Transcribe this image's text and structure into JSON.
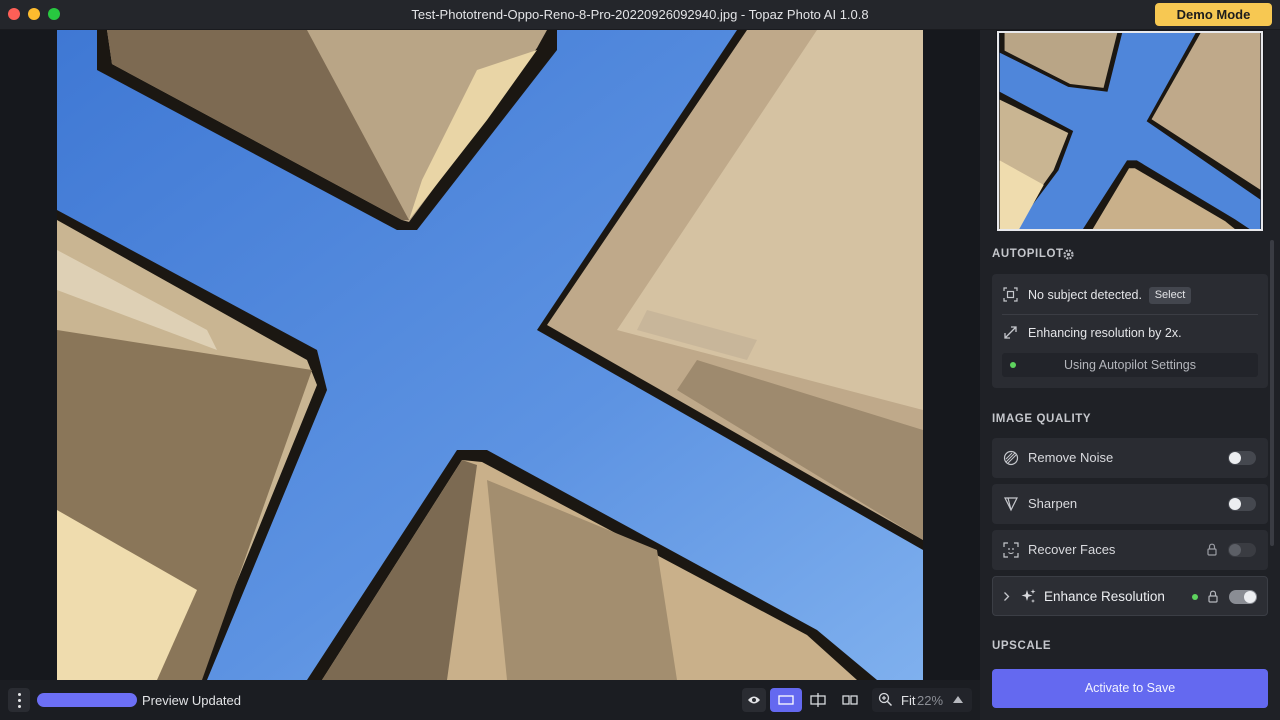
{
  "window": {
    "title": "Test-Phototrend-Oppo-Reno-8-Pro-20220926092940.jpg - Topaz Photo AI 1.0.8",
    "demo_button": "Demo Mode"
  },
  "bottom_bar": {
    "status": "Preview Updated",
    "progress_fraction": 1.0,
    "zoom_fit": "Fit",
    "zoom_percent": "22%"
  },
  "autopilot": {
    "title": "AUTOPILOT",
    "subject_text": "No subject detected.",
    "select_label": "Select",
    "resolution_text": "Enhancing resolution by 2x.",
    "settings_label": "Using Autopilot Settings"
  },
  "image_quality": {
    "title": "IMAGE QUALITY",
    "filters": [
      {
        "label": "Remove Noise",
        "enabled": false,
        "locked": false
      },
      {
        "label": "Sharpen",
        "enabled": false,
        "locked": false
      },
      {
        "label": "Recover Faces",
        "enabled": false,
        "locked": true
      },
      {
        "label": "Enhance Resolution",
        "enabled": true,
        "locked": true
      }
    ]
  },
  "upscale": {
    "title": "UPSCALE"
  },
  "actions": {
    "activate_label": "Activate to Save"
  },
  "colors": {
    "accent": "#6469f0",
    "demo": "#f7c852",
    "active_dot": "#5ed35e"
  }
}
